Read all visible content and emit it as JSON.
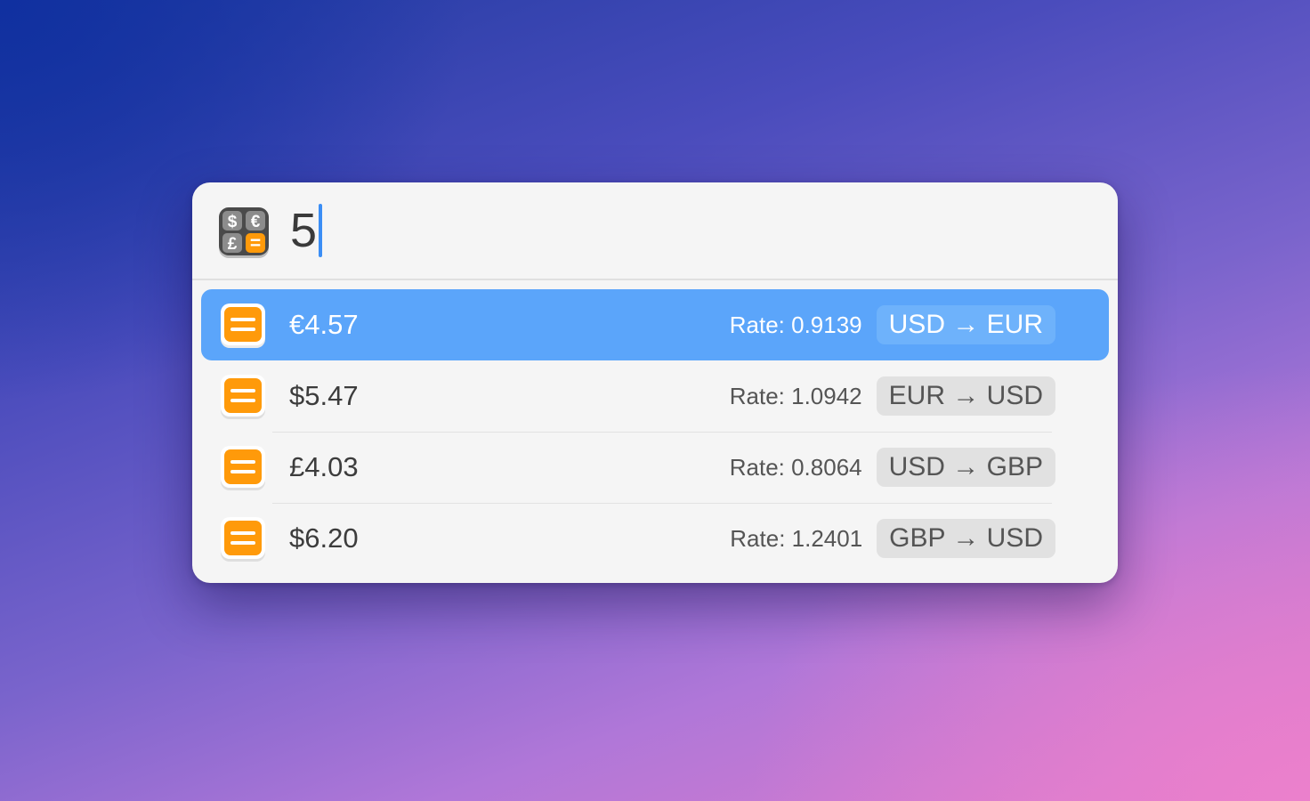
{
  "search": {
    "query": "5"
  },
  "icons": {
    "app": "currency-calculator-icon",
    "result": "equals-icon"
  },
  "app_icon_symbols": [
    "$",
    "€",
    "£",
    "="
  ],
  "colors": {
    "selection": "#5ba5fa",
    "caret": "#3b8ef5",
    "icon_orange": "#ff9a0a",
    "window_background": "#f5f5f5"
  },
  "results": [
    {
      "value": "€4.57",
      "rate": "Rate: 0.9139",
      "pair": "USD → EUR",
      "selected": true
    },
    {
      "value": "$5.47",
      "rate": "Rate: 1.0942",
      "pair": "EUR → USD",
      "selected": false
    },
    {
      "value": "£4.03",
      "rate": "Rate: 0.8064",
      "pair": "USD → GBP",
      "selected": false
    },
    {
      "value": "$6.20",
      "rate": "Rate: 1.2401",
      "pair": "GBP → USD",
      "selected": false
    }
  ]
}
